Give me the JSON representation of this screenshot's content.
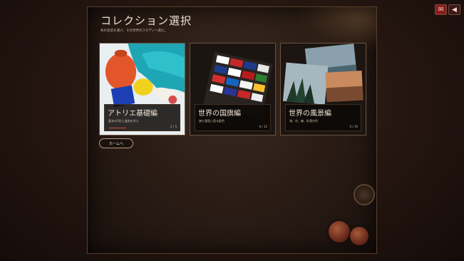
{
  "header": {
    "mail_icon": "mail-icon",
    "sound_icon": "speaker-icon"
  },
  "page": {
    "title": "コレクション選択",
    "subtitle": "色の名前を選び、その世界のスタディへ進む。"
  },
  "collections": [
    {
      "title": "アトリエ基礎編",
      "description": "基本の5色と道具を学ぶ",
      "progress_text": "2 / 5",
      "progress_fraction": 0.4
    },
    {
      "title": "世界の国旗編",
      "description": "旗と意匠に宿る配色",
      "progress_text": "0 / 12",
      "progress_fraction": 0
    },
    {
      "title": "世界の風景編",
      "description": "海、空、森、砂漠の色",
      "progress_text": "0 / 10",
      "progress_fraction": 0
    }
  ],
  "home_button": {
    "label": "ホームへ"
  },
  "colors": {
    "accent": "#c8513a",
    "background": "#241510",
    "text": "#efe3d4"
  }
}
